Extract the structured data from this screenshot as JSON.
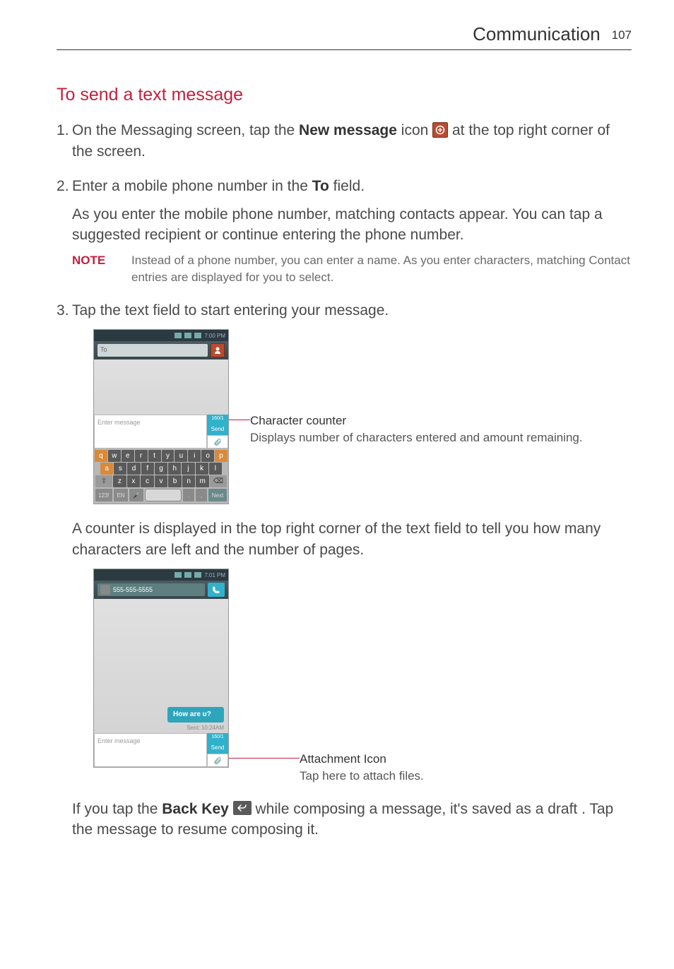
{
  "header": {
    "chapter": "Communication",
    "page": "107"
  },
  "section_title": "To send a text message",
  "steps": {
    "s1": {
      "pre": "On the Messaging screen, tap the ",
      "term": "New message",
      "mid": " icon ",
      "post": " at the top right corner of the screen."
    },
    "s2": {
      "line1_pre": "Enter a mobile phone number in the ",
      "line1_term": "To",
      "line1_post": " field.",
      "para2": "As you enter the mobile phone number, matching contacts appear. You can tap a suggested recipient or continue entering the phone number."
    },
    "note": {
      "label": "NOTE",
      "body": "Instead of a phone number, you can enter a name. As you enter characters, matching Contact entries are displayed for you to select."
    },
    "s3": {
      "text": "Tap the text field to start entering your message."
    },
    "s3_followup": "A counter is displayed in the top right corner of the text field to tell you how many characters are left and the number of pages.",
    "back_para": {
      "pre": "If you tap the ",
      "term": "Back Key",
      "post": " while composing a message, it's saved as a draft . Tap the message to resume composing it."
    }
  },
  "figure1": {
    "status_time": "7:00 PM",
    "to_placeholder": "To",
    "msg_placeholder": "Enter message",
    "counter": "160/1",
    "send": "Send",
    "kb": {
      "r1": [
        "q",
        "w",
        "e",
        "r",
        "t",
        "y",
        "u",
        "i",
        "o",
        "p"
      ],
      "r2": [
        "a",
        "s",
        "d",
        "f",
        "g",
        "h",
        "j",
        "k",
        "l"
      ],
      "r3": [
        "⇧",
        "z",
        "x",
        "c",
        "v",
        "b",
        "n",
        "m",
        "⌫"
      ],
      "bot": {
        "num": "123!",
        "lang": "EN",
        "mic": "🎤",
        "dot": ".",
        "comma": ",",
        "next": "Next"
      }
    },
    "annot": {
      "title": "Character counter",
      "desc": "Displays number of characters entered and amount remaining."
    }
  },
  "figure2": {
    "status_time": "7:01 PM",
    "contact": "555-555-5555",
    "bubble": "How are u?",
    "sent_ts": "Sent: 10:24AM",
    "msg_placeholder": "Enter message",
    "counter": "160/1",
    "send": "Send",
    "annot": {
      "title": "Attachment Icon",
      "desc": "Tap here to attach files."
    }
  }
}
